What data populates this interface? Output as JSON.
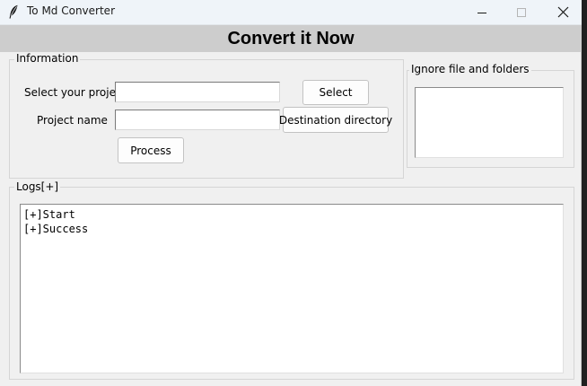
{
  "window": {
    "title": "To Md Converter",
    "icon": "feather-icon",
    "controls": [
      "minimize-icon",
      "maximize-icon",
      "close-icon"
    ]
  },
  "header": {
    "title": "Convert it Now"
  },
  "information": {
    "group_label": "Information",
    "project_label": "Select your project",
    "project_value": "",
    "select_button": "Select",
    "name_label": "Project name",
    "name_value": "",
    "destination_button": "Destination directory",
    "process_button": "Process"
  },
  "ignore": {
    "group_label": "Ignore file and folders",
    "value": ""
  },
  "logs": {
    "group_label": "Logs[+]",
    "lines": [
      "[+]Start",
      "[+]Success"
    ]
  }
}
